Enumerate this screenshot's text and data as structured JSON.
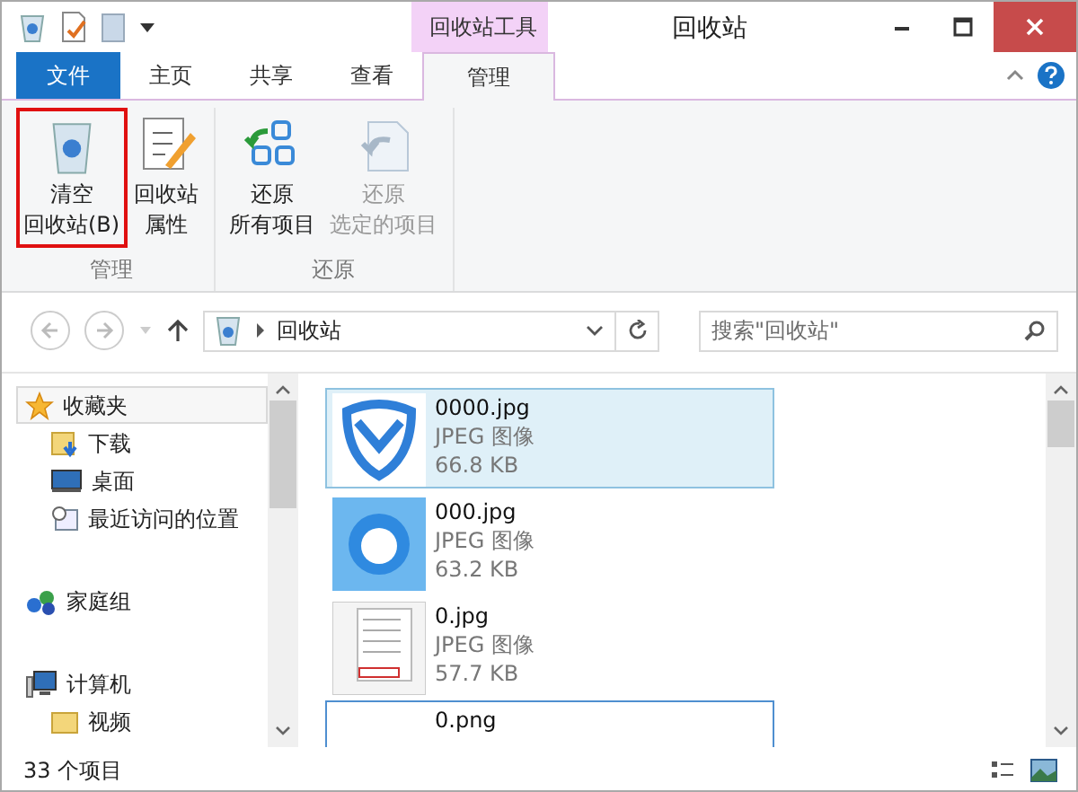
{
  "window": {
    "title": "回收站",
    "context_tab_group": "回收站工具"
  },
  "ribbon_tabs": [
    {
      "label": "文件",
      "kind": "file",
      "selected": false
    },
    {
      "label": "主页",
      "kind": "tab",
      "selected": false
    },
    {
      "label": "共享",
      "kind": "tab",
      "selected": false
    },
    {
      "label": "查看",
      "kind": "tab",
      "selected": false
    },
    {
      "label": "管理",
      "kind": "context",
      "selected": true
    }
  ],
  "ribbon_groups": [
    {
      "label": "管理",
      "buttons": [
        {
          "lines": [
            "清空",
            "回收站(B)"
          ],
          "disabled": false,
          "highlighted": true
        },
        {
          "lines": [
            "回收站",
            "属性"
          ],
          "disabled": false,
          "highlighted": false
        }
      ]
    },
    {
      "label": "还原",
      "buttons": [
        {
          "lines": [
            "还原",
            "所有项目"
          ],
          "disabled": false,
          "highlighted": false
        },
        {
          "lines": [
            "还原",
            "选定的项目"
          ],
          "disabled": true,
          "highlighted": false
        }
      ]
    }
  ],
  "address_bar": {
    "path": "回收站"
  },
  "search": {
    "placeholder": "搜索\"回收站\""
  },
  "nav_tree": [
    {
      "label": "收藏夹",
      "selected": true,
      "children": [
        {
          "label": "下载",
          "selected": false
        },
        {
          "label": "桌面",
          "selected": false
        },
        {
          "label": "最近访问的位置",
          "selected": false
        }
      ]
    },
    {
      "label": "家庭组",
      "selected": false
    },
    {
      "label": "计算机",
      "selected": false,
      "children": [
        {
          "label": "视频",
          "selected": false
        }
      ]
    }
  ],
  "files": [
    {
      "name": "0000.jpg",
      "type": "JPEG 图像",
      "size": "66.8 KB",
      "selected": true,
      "focused": false
    },
    {
      "name": "000.jpg",
      "type": "JPEG 图像",
      "size": "63.2 KB",
      "selected": false,
      "focused": false
    },
    {
      "name": "0.jpg",
      "type": "JPEG 图像",
      "size": "57.7 KB",
      "selected": false,
      "focused": false
    },
    {
      "name": "0.png",
      "selected": false,
      "focused": true
    }
  ],
  "status_bar": {
    "item_count": "33 个项目"
  }
}
